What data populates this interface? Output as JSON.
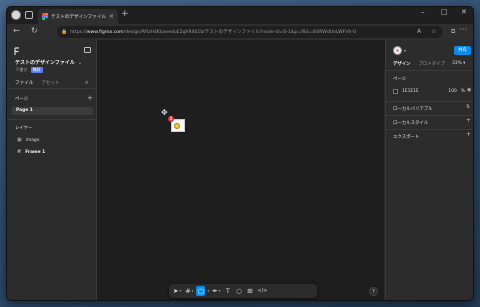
{
  "browser": {
    "tab_title": "テストのデザインファイル – Figma",
    "tab_close": "×",
    "new_tab": "+",
    "url_prefix": "https://",
    "url_domain": "www.figma.com",
    "url_path": "/design/RRzH4KkaeeduE2gh9Xb1b/テストのデザインファイル?node-id=0-1&p=f&t=4ISRWdUnLWFVh-0",
    "minimize": "–",
    "maximize": "□",
    "close": "✕",
    "back": "←",
    "reload": "↻",
    "more": "···",
    "icons": [
      "back-icon",
      "reload-icon",
      "lock-icon",
      "read-aloud-icon",
      "favorite-star-icon",
      "extensions-icon"
    ]
  },
  "left_panel": {
    "file_name": "テストのデザインファイル",
    "file_caret": "⌄",
    "drafts_label": "下書き",
    "free_badge": "無料",
    "tabs": [
      "ファイル",
      "アセット"
    ],
    "pages_header": "ページ",
    "add": "+",
    "page_item": "Page 1",
    "layers_header": "レイヤー",
    "layers": [
      {
        "name": "image",
        "icon": "image-icon",
        "glyph": "▣"
      },
      {
        "name": "Frame 1",
        "icon": "frame-icon",
        "glyph": "#"
      }
    ]
  },
  "canvas": {
    "badge_count": "1",
    "tools": [
      {
        "icon": "move-tool-icon",
        "glyph": "➤",
        "active": false,
        "dropdown": true
      },
      {
        "icon": "frame-tool-icon",
        "glyph": "#",
        "active": false,
        "dropdown": true
      },
      {
        "icon": "rectangle-tool-icon",
        "glyph": "▢",
        "active": true,
        "dropdown": true
      },
      {
        "icon": "pen-tool-icon",
        "glyph": "✒",
        "active": false,
        "dropdown": true
      },
      {
        "icon": "text-tool-icon",
        "glyph": "T",
        "active": false,
        "dropdown": false
      },
      {
        "icon": "comment-tool-icon",
        "glyph": "○",
        "active": false,
        "dropdown": false
      },
      {
        "icon": "actions-tool-icon",
        "glyph": "⊞",
        "active": false,
        "dropdown": false
      },
      {
        "icon": "dev-mode-icon",
        "glyph": "</>",
        "active": false,
        "dropdown": false
      }
    ],
    "dropdown_glyph": "▾",
    "help": "?"
  },
  "right_panel": {
    "share": "共有",
    "tabs": [
      "デザイン",
      "プロトタイプ"
    ],
    "zoom": "33%",
    "page_header": "ページ",
    "background_hex": "1E1E1E",
    "background_opacity": "100",
    "percent": "%",
    "local_variables": "ローカルバリアブル",
    "local_styles": "ローカルスタイル",
    "export": "エクスポート",
    "add": "+",
    "variables_icon_glyph": "⇅",
    "eye_glyph": "◉"
  },
  "colors": {
    "accent": "#0c8ce9",
    "free_badge": "#5b7de4",
    "notification": "#e6323b",
    "canvas_bg": "#1e1e1e",
    "panel_bg": "#2c2c2c"
  }
}
